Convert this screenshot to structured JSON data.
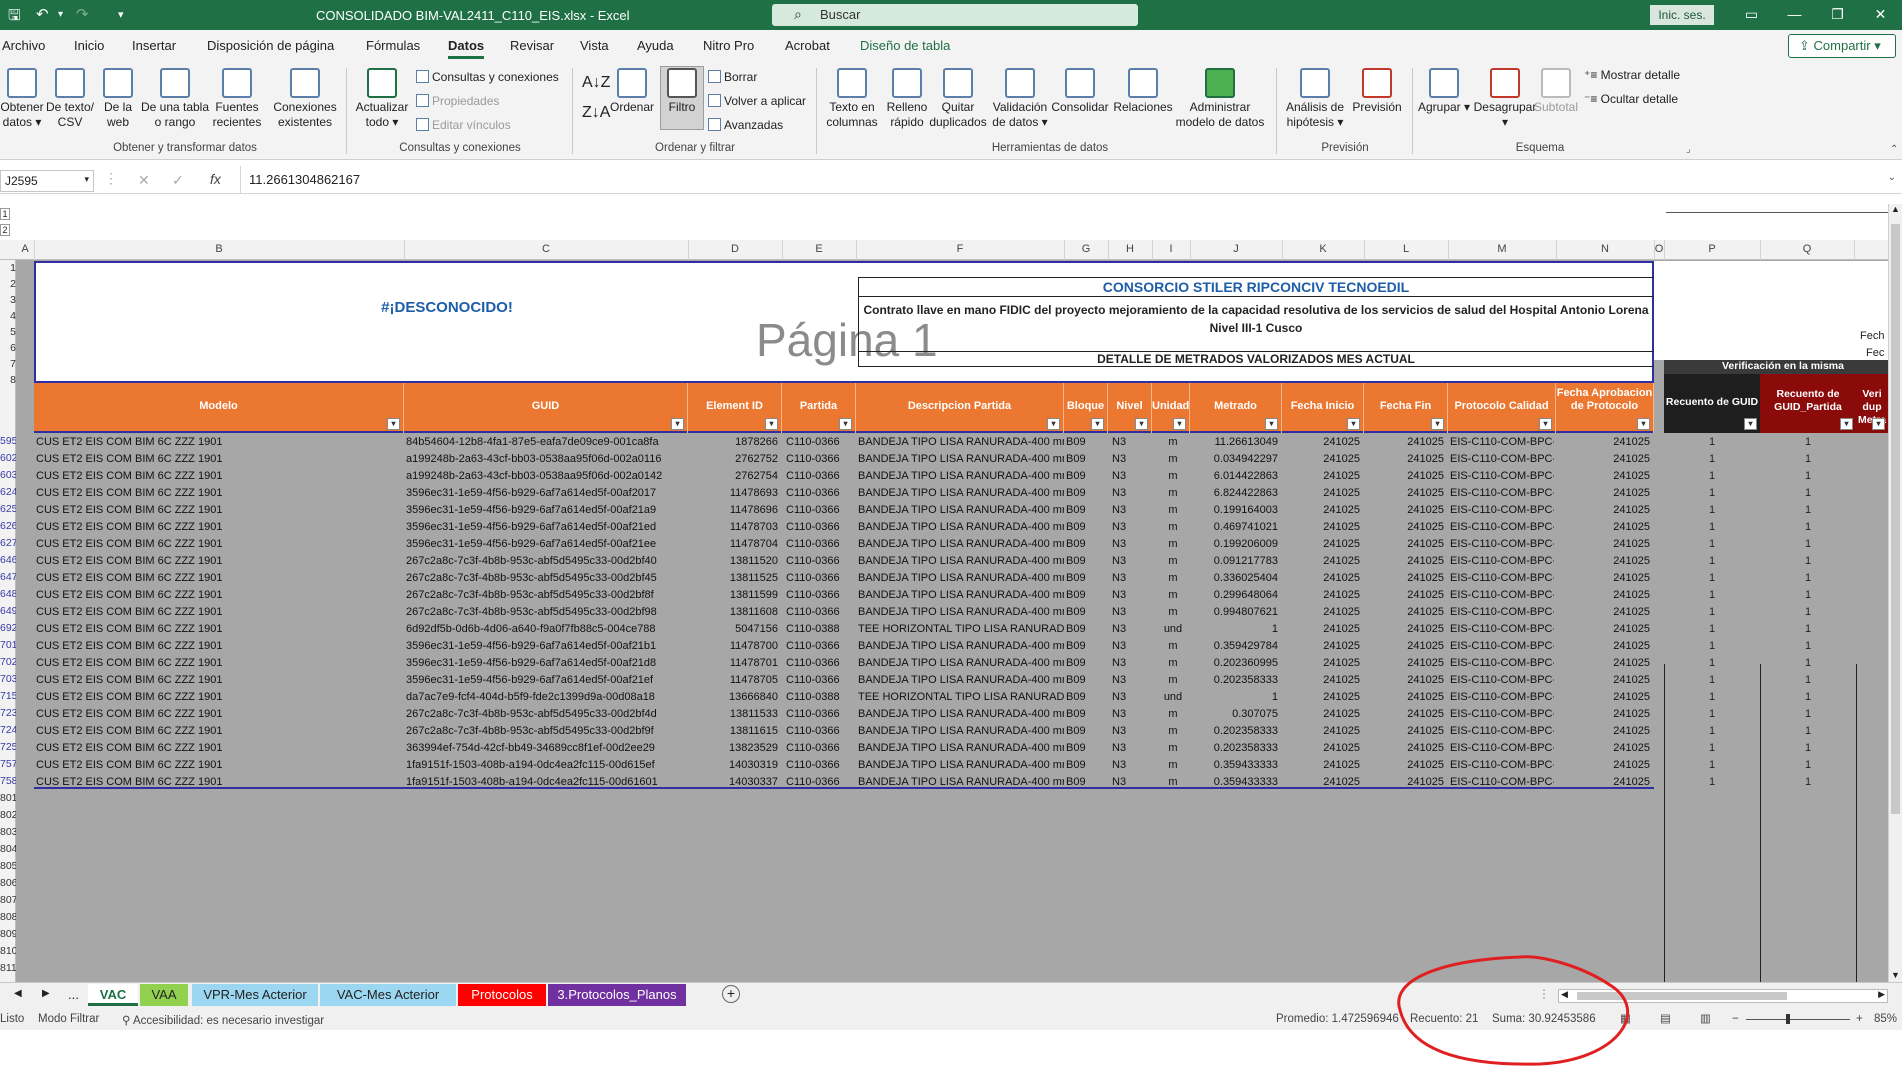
{
  "window": {
    "title": "CONSOLIDADO BIM-VAL2411_C110_EIS.xlsx  -  Excel",
    "search_placeholder": "Buscar",
    "signin_label": "Inic. ses."
  },
  "menu": {
    "items": [
      "Archivo",
      "Inicio",
      "Insertar",
      "Disposición de página",
      "Fórmulas",
      "Datos",
      "Revisar",
      "Vista",
      "Ayuda",
      "Nitro Pro",
      "Acrobat",
      "Diseño de tabla"
    ],
    "active": "Datos",
    "share_label": "Compartir"
  },
  "ribbon": {
    "group1": {
      "label": "Obtener y transformar datos",
      "buttons": [
        "Obtener datos",
        "De texto/ CSV",
        "De la web",
        "De una tabla o rango",
        "Fuentes recientes",
        "Conexiones existentes"
      ]
    },
    "group2": {
      "label": "Consultas y conexiones",
      "refresh": "Actualizar todo",
      "small": [
        "Consultas y conexiones",
        "Propiedades",
        "Editar vínculos"
      ]
    },
    "group3": {
      "label": "Ordenar y filtrar",
      "sort": "Ordenar",
      "filter": "Filtro",
      "small": [
        "Borrar",
        "Volver a aplicar",
        "Avanzadas"
      ]
    },
    "group4": {
      "label": "Herramientas de datos",
      "buttons": [
        "Texto en columnas",
        "Relleno rápido",
        "Quitar duplicados",
        "Validación de datos",
        "Consolidar",
        "Relaciones",
        "Administrar modelo de datos"
      ]
    },
    "group5": {
      "label": "Previsión",
      "buttons": [
        "Análisis de hipótesis",
        "Previsión"
      ]
    },
    "group6": {
      "label": "Esquema",
      "buttons": [
        "Agrupar",
        "Desagrupar",
        "Subtotal"
      ],
      "small": [
        "Mostrar detalle",
        "Ocultar detalle"
      ]
    }
  },
  "formula": {
    "cell": "J2595",
    "value": "11.2661304862167"
  },
  "columns": [
    "A",
    "B",
    "C",
    "D",
    "E",
    "F",
    "G",
    "H",
    "I",
    "J",
    "K",
    "L",
    "M",
    "N",
    "O",
    "P",
    "Q"
  ],
  "rows_top": [
    "1",
    "2",
    "3",
    "4",
    "5",
    "6",
    "7",
    "8"
  ],
  "report": {
    "error_text": "#¡DESCONOCIDO!",
    "page_watermark": "Página 1",
    "company": "CONSORCIO STILER RIPCONCIV TECNOEDIL",
    "contract": "Contrato llave en mano FIDIC del proyecto mejoramiento de la capacidad resolutiva de los servicios de salud del Hospital Antonio Lorena Nivel III-1 Cusco",
    "detail": "DETALLE DE METRADOS VALORIZADOS MES ACTUAL",
    "fecha1": "Fech",
    "fecha2": "Fec",
    "verif": "Verificación en la misma"
  },
  "table": {
    "headers": [
      "Modelo",
      "GUID",
      "Element ID",
      "Partida",
      "Descripcion Partida",
      "Bloque",
      "Nivel",
      "Unidad",
      "Metrado",
      "Fecha Inicio",
      "Fecha Fin",
      "Protocolo Calidad",
      "Fecha Aprobacion de Protocolo"
    ],
    "right_headers": [
      "Recuento de GUID",
      "Recuento de GUID_Partida",
      "Veri dup Metra"
    ],
    "row_numbers": [
      "595",
      "602",
      "603",
      "624",
      "625",
      "626",
      "627",
      "646",
      "647",
      "648",
      "649",
      "692",
      "701",
      "702",
      "703",
      "715",
      "723",
      "724",
      "725",
      "757",
      "758",
      "801",
      "802",
      "803",
      "804",
      "805",
      "806",
      "807",
      "808",
      "809",
      "810",
      "811"
    ],
    "rows": [
      [
        "CUS ET2 EIS COM BIM 6C ZZZ 1901",
        "84b54604-12b8-4fa1-87e5-eafa7de09ce9-001ca8fa",
        "1878266",
        "C110-0366",
        "BANDEJA TIPO LISA RANURADA-400 mmx10",
        "B09",
        "N3",
        "m",
        "11.26613049",
        "241025",
        "241025",
        "EIS-C110-COM-BPC-0017",
        "241025",
        "1",
        "1"
      ],
      [
        "CUS ET2 EIS COM BIM 6C ZZZ 1901",
        "a199248b-2a63-43cf-bb03-0538aa95f06d-002a0116",
        "2762752",
        "C110-0366",
        "BANDEJA TIPO LISA RANURADA-400 mmx10",
        "B09",
        "N3",
        "m",
        "0.034942297",
        "241025",
        "241025",
        "EIS-C110-COM-BPC-0017",
        "241025",
        "1",
        "1"
      ],
      [
        "CUS ET2 EIS COM BIM 6C ZZZ 1901",
        "a199248b-2a63-43cf-bb03-0538aa95f06d-002a0142",
        "2762754",
        "C110-0366",
        "BANDEJA TIPO LISA RANURADA-400 mmx10",
        "B09",
        "N3",
        "m",
        "6.014422863",
        "241025",
        "241025",
        "EIS-C110-COM-BPC-0017",
        "241025",
        "1",
        "1"
      ],
      [
        "CUS ET2 EIS COM BIM 6C ZZZ 1901",
        "3596ec31-1e59-4f56-b929-6af7a614ed5f-00af2017",
        "11478693",
        "C110-0366",
        "BANDEJA TIPO LISA RANURADA-400 mmx10",
        "B09",
        "N3",
        "m",
        "6.824422863",
        "241025",
        "241025",
        "EIS-C110-COM-BPC-0017",
        "241025",
        "1",
        "1"
      ],
      [
        "CUS ET2 EIS COM BIM 6C ZZZ 1901",
        "3596ec31-1e59-4f56-b929-6af7a614ed5f-00af21a9",
        "11478696",
        "C110-0366",
        "BANDEJA TIPO LISA RANURADA-400 mmx10",
        "B09",
        "N3",
        "m",
        "0.199164003",
        "241025",
        "241025",
        "EIS-C110-COM-BPC-0017",
        "241025",
        "1",
        "1"
      ],
      [
        "CUS ET2 EIS COM BIM 6C ZZZ 1901",
        "3596ec31-1e59-4f56-b929-6af7a614ed5f-00af21ed",
        "11478703",
        "C110-0366",
        "BANDEJA TIPO LISA RANURADA-400 mmx10",
        "B09",
        "N3",
        "m",
        "0.469741021",
        "241025",
        "241025",
        "EIS-C110-COM-BPC-0017",
        "241025",
        "1",
        "1"
      ],
      [
        "CUS ET2 EIS COM BIM 6C ZZZ 1901",
        "3596ec31-1e59-4f56-b929-6af7a614ed5f-00af21ee",
        "11478704",
        "C110-0366",
        "BANDEJA TIPO LISA RANURADA-400 mmx10",
        "B09",
        "N3",
        "m",
        "0.199206009",
        "241025",
        "241025",
        "EIS-C110-COM-BPC-0017",
        "241025",
        "1",
        "1"
      ],
      [
        "CUS ET2 EIS COM BIM 6C ZZZ 1901",
        "267c2a8c-7c3f-4b8b-953c-abf5d5495c33-00d2bf40",
        "13811520",
        "C110-0366",
        "BANDEJA TIPO LISA RANURADA-400 mmx10",
        "B09",
        "N3",
        "m",
        "0.091217783",
        "241025",
        "241025",
        "EIS-C110-COM-BPC-0017",
        "241025",
        "1",
        "1"
      ],
      [
        "CUS ET2 EIS COM BIM 6C ZZZ 1901",
        "267c2a8c-7c3f-4b8b-953c-abf5d5495c33-00d2bf45",
        "13811525",
        "C110-0366",
        "BANDEJA TIPO LISA RANURADA-400 mmx10",
        "B09",
        "N3",
        "m",
        "0.336025404",
        "241025",
        "241025",
        "EIS-C110-COM-BPC-0017",
        "241025",
        "1",
        "1"
      ],
      [
        "CUS ET2 EIS COM BIM 6C ZZZ 1901",
        "267c2a8c-7c3f-4b8b-953c-abf5d5495c33-00d2bf8f",
        "13811599",
        "C110-0366",
        "BANDEJA TIPO LISA RANURADA-400 mmx10",
        "B09",
        "N3",
        "m",
        "0.299648064",
        "241025",
        "241025",
        "EIS-C110-COM-BPC-0017",
        "241025",
        "1",
        "1"
      ],
      [
        "CUS ET2 EIS COM BIM 6C ZZZ 1901",
        "267c2a8c-7c3f-4b8b-953c-abf5d5495c33-00d2bf98",
        "13811608",
        "C110-0366",
        "BANDEJA TIPO LISA RANURADA-400 mmx10",
        "B09",
        "N3",
        "m",
        "0.994807621",
        "241025",
        "241025",
        "EIS-C110-COM-BPC-0017",
        "241025",
        "1",
        "1"
      ],
      [
        "CUS ET2 EIS COM BIM 6C ZZZ 1901",
        "6d92df5b-0d6b-4d06-a640-f9a0f7fb88c5-004ce788",
        "5047156",
        "C110-0388",
        "TEE HORIZONTAL TIPO LISA RANURADA-400",
        "B09",
        "N3",
        "und",
        "1",
        "241025",
        "241025",
        "EIS-C110-COM-BPC-0017",
        "241025",
        "1",
        "1"
      ],
      [
        "CUS ET2 EIS COM BIM 6C ZZZ 1901",
        "3596ec31-1e59-4f56-b929-6af7a614ed5f-00af21b1",
        "11478700",
        "C110-0366",
        "BANDEJA TIPO LISA RANURADA-400 mmx10",
        "B09",
        "N3",
        "m",
        "0.359429784",
        "241025",
        "241025",
        "EIS-C110-COM-BPC-0017",
        "241025",
        "1",
        "1"
      ],
      [
        "CUS ET2 EIS COM BIM 6C ZZZ 1901",
        "3596ec31-1e59-4f56-b929-6af7a614ed5f-00af21d8",
        "11478701",
        "C110-0366",
        "BANDEJA TIPO LISA RANURADA-400 mmx10",
        "B09",
        "N3",
        "m",
        "0.202360995",
        "241025",
        "241025",
        "EIS-C110-COM-BPC-0017",
        "241025",
        "1",
        "1"
      ],
      [
        "CUS ET2 EIS COM BIM 6C ZZZ 1901",
        "3596ec31-1e59-4f56-b929-6af7a614ed5f-00af21ef",
        "11478705",
        "C110-0366",
        "BANDEJA TIPO LISA RANURADA-400 mmx10",
        "B09",
        "N3",
        "m",
        "0.202358333",
        "241025",
        "241025",
        "EIS-C110-COM-BPC-0017",
        "241025",
        "1",
        "1"
      ],
      [
        "CUS ET2 EIS COM BIM 6C ZZZ 1901",
        "da7ac7e9-fcf4-404d-b5f9-fde2c1399d9a-00d08a18",
        "13666840",
        "C110-0388",
        "TEE HORIZONTAL TIPO LISA RANURADA-400",
        "B09",
        "N3",
        "und",
        "1",
        "241025",
        "241025",
        "EIS-C110-COM-BPC-0017",
        "241025",
        "1",
        "1"
      ],
      [
        "CUS ET2 EIS COM BIM 6C ZZZ 1901",
        "267c2a8c-7c3f-4b8b-953c-abf5d5495c33-00d2bf4d",
        "13811533",
        "C110-0366",
        "BANDEJA TIPO LISA RANURADA-400 mmx10",
        "B09",
        "N3",
        "m",
        "0.307075",
        "241025",
        "241025",
        "EIS-C110-COM-BPC-0017",
        "241025",
        "1",
        "1"
      ],
      [
        "CUS ET2 EIS COM BIM 6C ZZZ 1901",
        "267c2a8c-7c3f-4b8b-953c-abf5d5495c33-00d2bf9f",
        "13811615",
        "C110-0366",
        "BANDEJA TIPO LISA RANURADA-400 mmx10",
        "B09",
        "N3",
        "m",
        "0.202358333",
        "241025",
        "241025",
        "EIS-C110-COM-BPC-0017",
        "241025",
        "1",
        "1"
      ],
      [
        "CUS ET2 EIS COM BIM 6C ZZZ 1901",
        "363994ef-754d-42cf-bb49-34689cc8f1ef-00d2ee29",
        "13823529",
        "C110-0366",
        "BANDEJA TIPO LISA RANURADA-400 mmx10",
        "B09",
        "N3",
        "m",
        "0.202358333",
        "241025",
        "241025",
        "EIS-C110-COM-BPC-0017",
        "241025",
        "1",
        "1"
      ],
      [
        "CUS ET2 EIS COM BIM 6C ZZZ 1901",
        "1fa9151f-1503-408b-a194-0dc4ea2fc115-00d615ef",
        "14030319",
        "C110-0366",
        "BANDEJA TIPO LISA RANURADA-400 mmx10",
        "B09",
        "N3",
        "m",
        "0.359433333",
        "241025",
        "241025",
        "EIS-C110-COM-BPC-0017",
        "241025",
        "1",
        "1"
      ],
      [
        "CUS ET2 EIS COM BIM 6C ZZZ 1901",
        "1fa9151f-1503-408b-a194-0dc4ea2fc115-00d61601",
        "14030337",
        "C110-0366",
        "BANDEJA TIPO LISA RANURADA-400 mmx10",
        "B09",
        "N3",
        "m",
        "0.359433333",
        "241025",
        "241025",
        "EIS-C110-COM-BPC-0017",
        "241025",
        "1",
        "1"
      ]
    ]
  },
  "tabs": [
    {
      "label": "VAC",
      "color": "#ffffff"
    },
    {
      "label": "VAA",
      "color": "#92d050"
    },
    {
      "label": "VPR-Mes Acterior",
      "color": "#9bd7f0"
    },
    {
      "label": "VAC-Mes Acterior",
      "color": "#9bd7f0"
    },
    {
      "label": "Protocolos",
      "color": "#ff0000"
    },
    {
      "label": "3.Protocolos_Planos",
      "color": "#7030a0"
    }
  ],
  "tab_nav": {
    "ellipsis": "..."
  },
  "status": {
    "ready": "Listo",
    "mode": "Modo Filtrar",
    "accessibility": "Accesibilidad: es necesario investigar",
    "promedio": "Promedio: 1.472596946",
    "recuento": "Recuento: 21",
    "suma": "Suma: 30.92453586",
    "zoom": "85%"
  },
  "colors": {
    "accent": "#1f7145",
    "table_header": "#ec7731",
    "annotation": "#e02020"
  }
}
